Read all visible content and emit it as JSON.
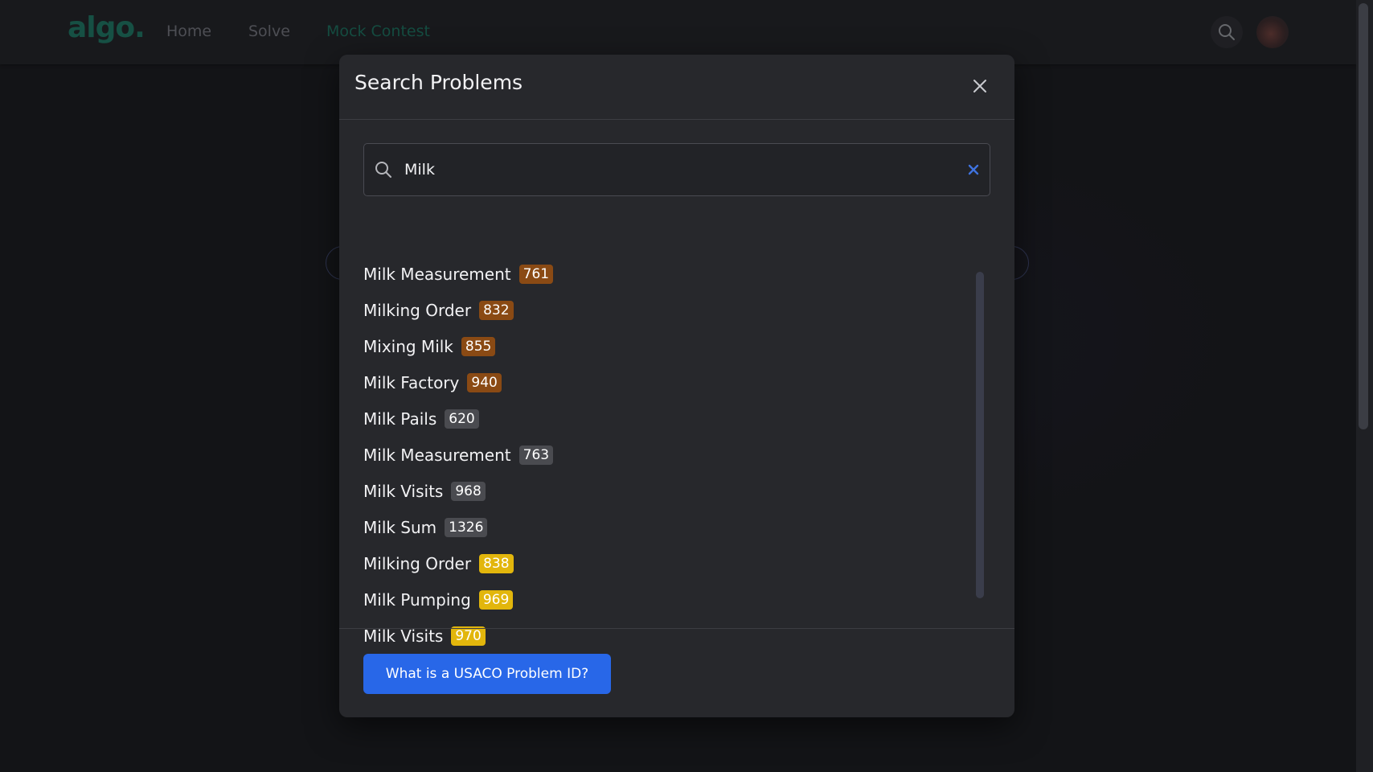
{
  "nav": {
    "logo": "algo.",
    "links": [
      {
        "label": "Home"
      },
      {
        "label": "Solve"
      },
      {
        "label": "Mock Contest"
      }
    ],
    "search_icon": "search-icon",
    "avatar": "user-avatar"
  },
  "modal": {
    "title": "Search Problems",
    "close_icon": "close-icon",
    "search": {
      "icon": "search-icon",
      "value": "Milk",
      "clear_icon": "clear-icon"
    },
    "results": [
      {
        "name": "Milk Measurement",
        "id": "761",
        "tier": "bronze"
      },
      {
        "name": "Milking Order",
        "id": "832",
        "tier": "bronze"
      },
      {
        "name": "Mixing Milk",
        "id": "855",
        "tier": "bronze"
      },
      {
        "name": "Milk Factory",
        "id": "940",
        "tier": "bronze"
      },
      {
        "name": "Milk Pails",
        "id": "620",
        "tier": "silver"
      },
      {
        "name": "Milk Measurement",
        "id": "763",
        "tier": "silver"
      },
      {
        "name": "Milk Visits",
        "id": "968",
        "tier": "silver"
      },
      {
        "name": "Milk Sum",
        "id": "1326",
        "tier": "silver"
      },
      {
        "name": "Milking Order",
        "id": "838",
        "tier": "gold"
      },
      {
        "name": "Milk Pumping",
        "id": "969",
        "tier": "gold"
      },
      {
        "name": "Milk Visits",
        "id": "970",
        "tier": "gold"
      }
    ],
    "help_button_label": "What is a USACO Problem ID?"
  },
  "colors": {
    "accent_blue": "#2867e8",
    "bronze": "#8a4a14",
    "silver": "#4a4b50",
    "gold": "#e2b60c",
    "logo_green": "#1f6f5f"
  }
}
